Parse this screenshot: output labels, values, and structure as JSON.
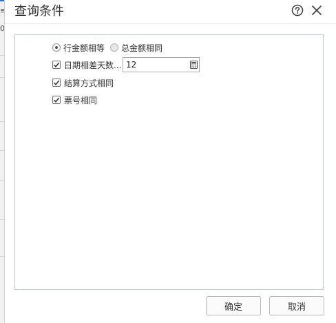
{
  "dialog": {
    "title": "查询条件",
    "help_icon": "help-icon",
    "close_icon": "close-icon"
  },
  "background": {
    "glyph_top": "≡",
    "glyph_second": "0"
  },
  "match_mode": {
    "options": [
      {
        "label": "行金额相等",
        "selected": true
      },
      {
        "label": "总金额相同",
        "selected": false
      }
    ]
  },
  "conditions": {
    "date_diff": {
      "label": "日期相差天数...",
      "checked": true,
      "value": "12",
      "icon": "calculator-icon"
    },
    "settlement": {
      "label": "结算方式相同",
      "checked": true
    },
    "ticket_no": {
      "label": "票号相同",
      "checked": true
    }
  },
  "buttons": {
    "confirm": "确定",
    "cancel": "取消"
  },
  "colors": {
    "panel_border": "#b9c7d4",
    "button_border": "#b6b6b6",
    "text": "#333333"
  }
}
